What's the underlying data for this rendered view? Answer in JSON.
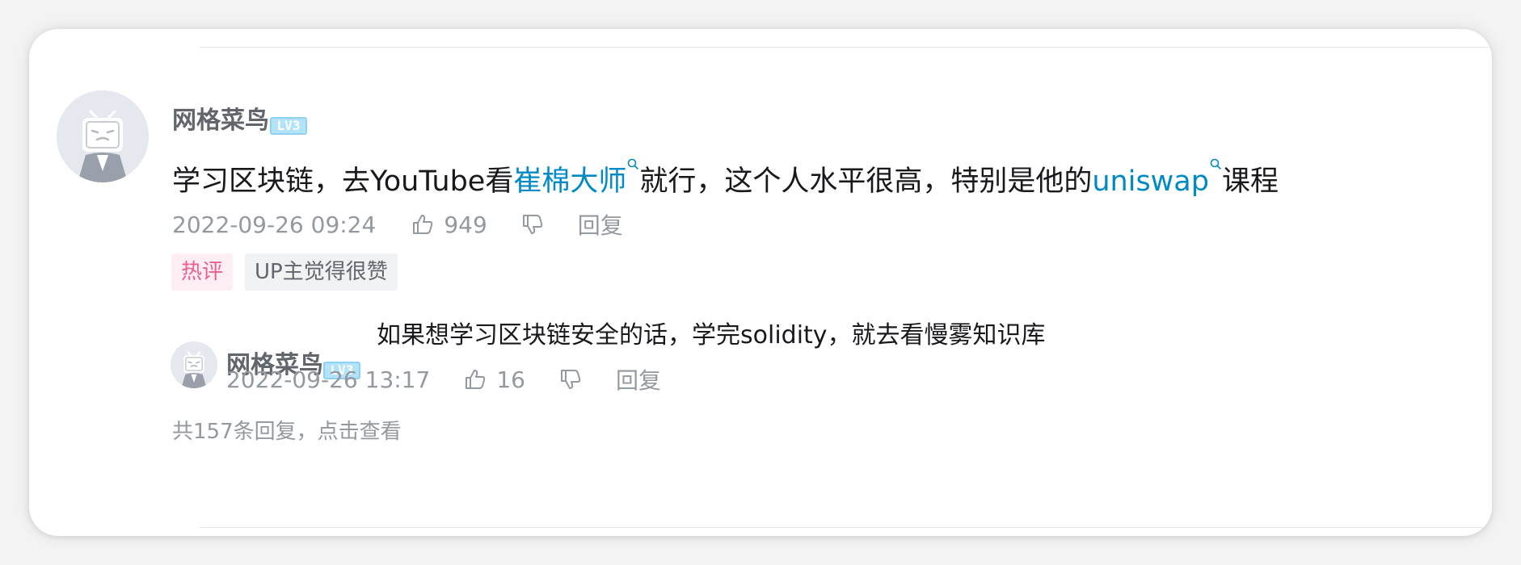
{
  "comment": {
    "username": "网格菜鸟",
    "level": "LV3",
    "text_parts": {
      "p1": "学习区块链，去YouTube看",
      "kw1": "崔棉大师",
      "p2": "就行，这个人水平很高，特别是他的",
      "kw2": "uniswap",
      "p3": "课程"
    },
    "time": "2022-09-26 09:24",
    "likes": "949",
    "reply_label": "回复",
    "tags": {
      "hot": "热评",
      "up": "UP主觉得很赞"
    }
  },
  "reply": {
    "username": "网格菜鸟",
    "level": "LV3",
    "text": "如果想学习区块链安全的话，学完solidity，就去看慢雾知识库",
    "time": "2022-09-26 13:17",
    "likes": "16",
    "reply_label": "回复"
  },
  "view_more": "共157条回复，点击查看",
  "colors": {
    "keyword": "#008ac5",
    "hot_tag_text": "#ea5f8d",
    "hot_tag_bg": "#fdeef3",
    "meta_gray": "#9499a0",
    "level_badge": "#b3e3f8"
  },
  "icons": {
    "avatar": "tv-mascot-avatar",
    "search": "search-icon",
    "like": "thumbs-up-icon",
    "dislike": "thumbs-down-icon"
  }
}
